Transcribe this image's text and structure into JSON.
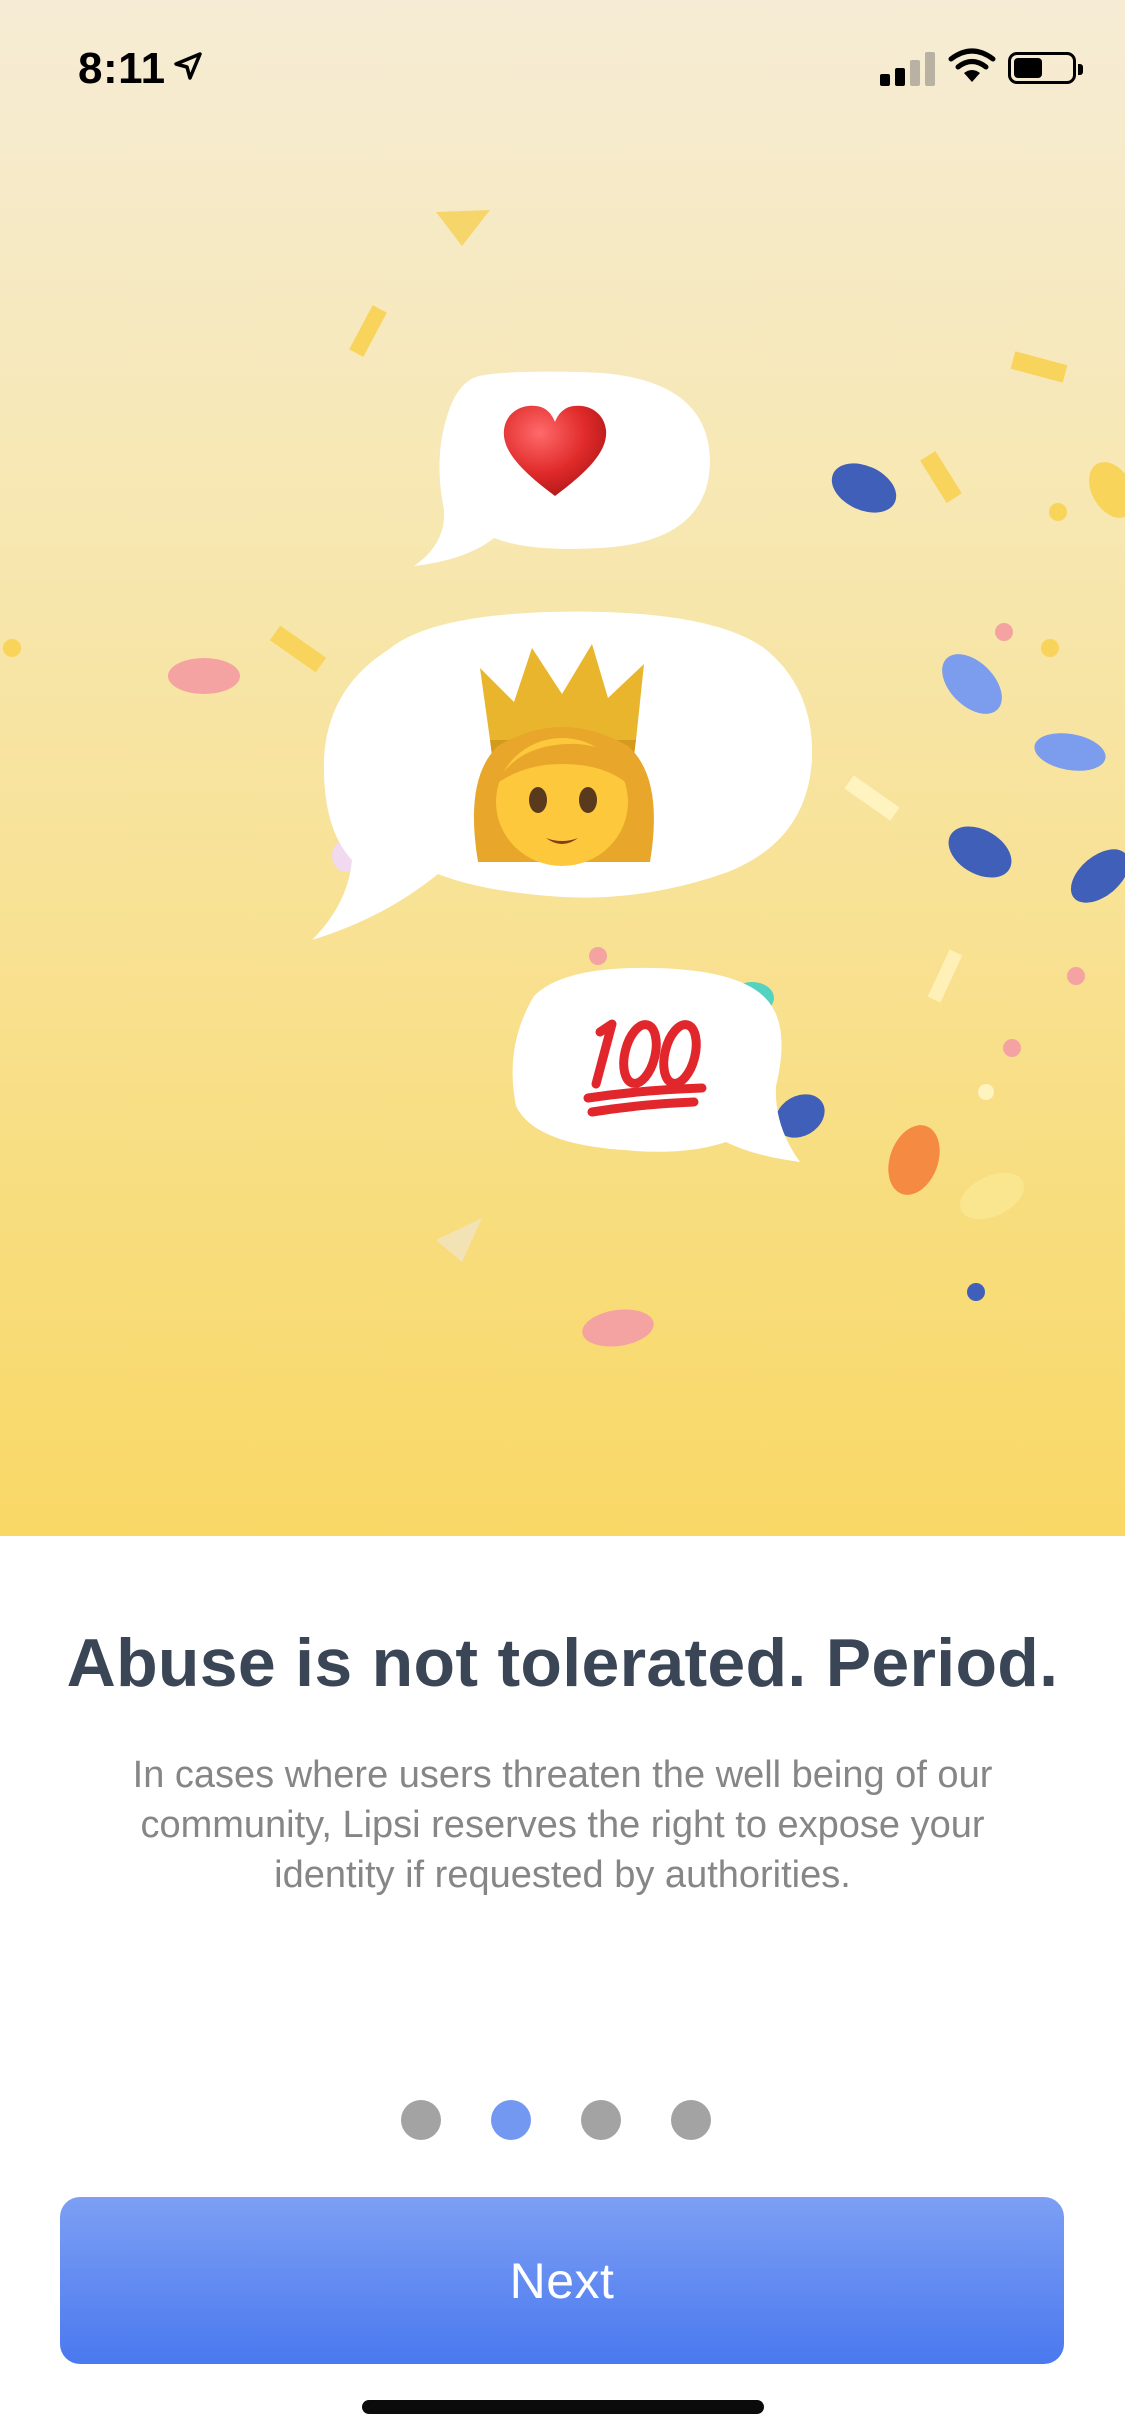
{
  "status_bar": {
    "time": "8:11",
    "icons": [
      "location-arrow-icon",
      "cellular-signal-icon",
      "wifi-icon",
      "battery-icon"
    ]
  },
  "hero": {
    "bubbles": [
      {
        "name": "heart-bubble",
        "icon": "red-heart-emoji",
        "glyph": "❤️"
      },
      {
        "name": "princess-bubble",
        "icon": "princess-emoji",
        "glyph": "👸"
      },
      {
        "name": "hundred-bubble",
        "icon": "hundred-points-emoji",
        "glyph": "💯"
      }
    ]
  },
  "onboarding": {
    "title": "Abuse is not tolerated. Period.",
    "description": "In cases where users threaten the well being of our community, Lipsi reserves the right to expose your identity if requested by authorities.",
    "page_count": 4,
    "current_page": 2
  },
  "actions": {
    "next_label": "Next"
  },
  "colors": {
    "accent": "#5b86f0",
    "title": "#3a4656",
    "body_text": "#868686",
    "dot_inactive": "#a3a3a3",
    "dot_active": "#7398f2"
  }
}
